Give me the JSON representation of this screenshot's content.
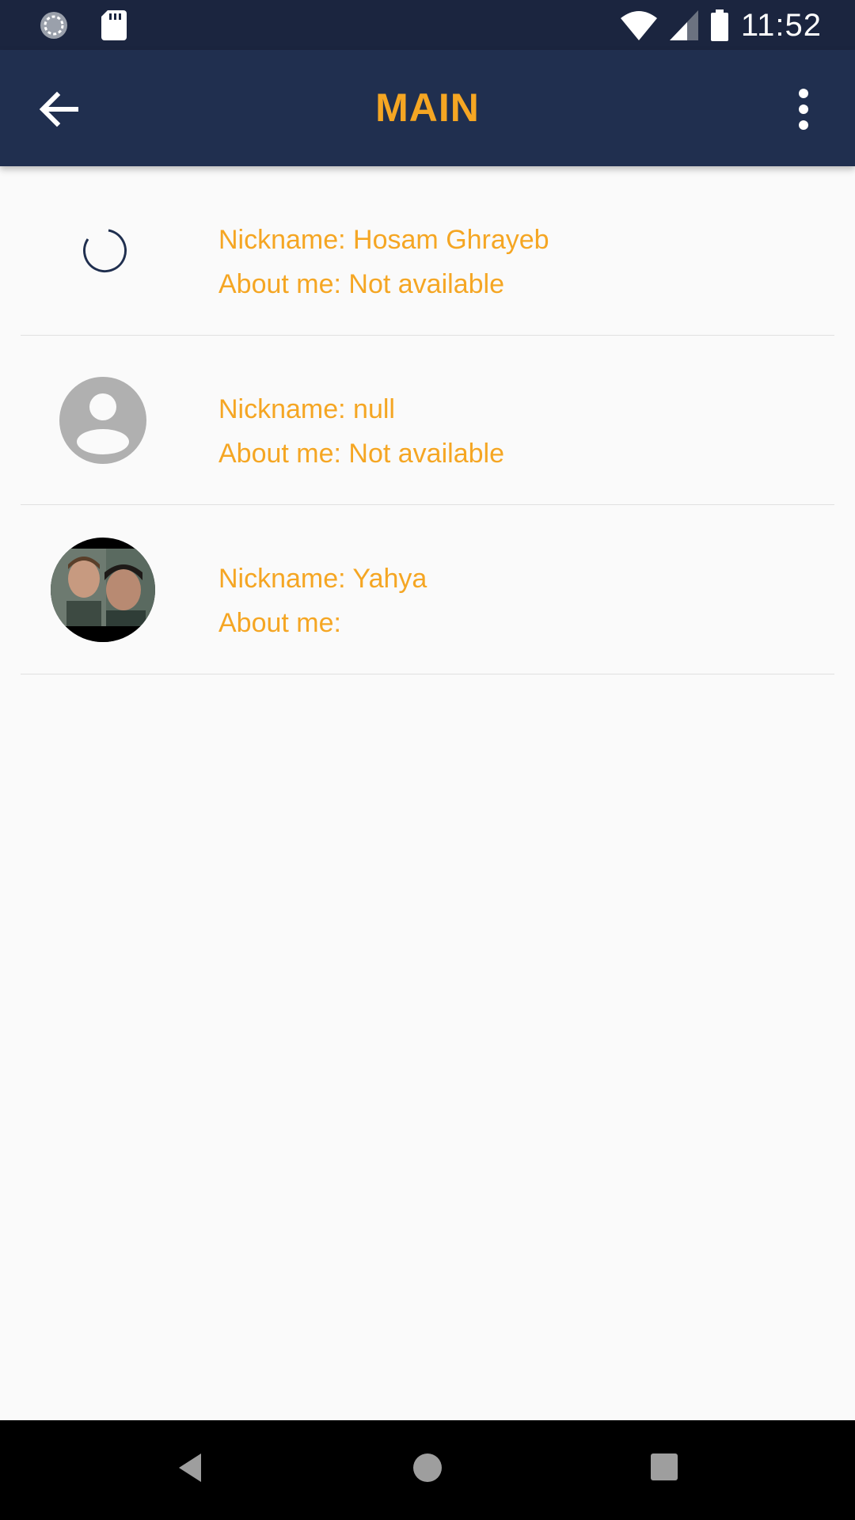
{
  "status_bar": {
    "time": "11:52",
    "icons": [
      "sync-icon",
      "sd-card-icon",
      "wifi-icon",
      "signal-icon",
      "battery-icon"
    ]
  },
  "app_bar": {
    "title": "MAIN",
    "back_icon": "arrow-back-icon",
    "menu_icon": "more-vert-icon"
  },
  "contacts": [
    {
      "avatar": "loading-spinner",
      "nickname": "Nickname: Hosam Ghrayeb",
      "about": "About me: Not available"
    },
    {
      "avatar": "default-person-icon",
      "nickname": "Nickname: null",
      "about": "About me: Not available"
    },
    {
      "avatar": "profile-photo",
      "nickname": "Nickname: Yahya",
      "about": "About me:"
    }
  ],
  "nav_bar": {
    "icons": [
      "nav-back-icon",
      "nav-home-icon",
      "nav-recents-icon"
    ]
  },
  "colors": {
    "accent": "#f5a623",
    "status_bar_bg": "#1b253f",
    "app_bar_bg": "#202f4f",
    "background": "#fafafa",
    "divider": "#e0e0e0"
  }
}
